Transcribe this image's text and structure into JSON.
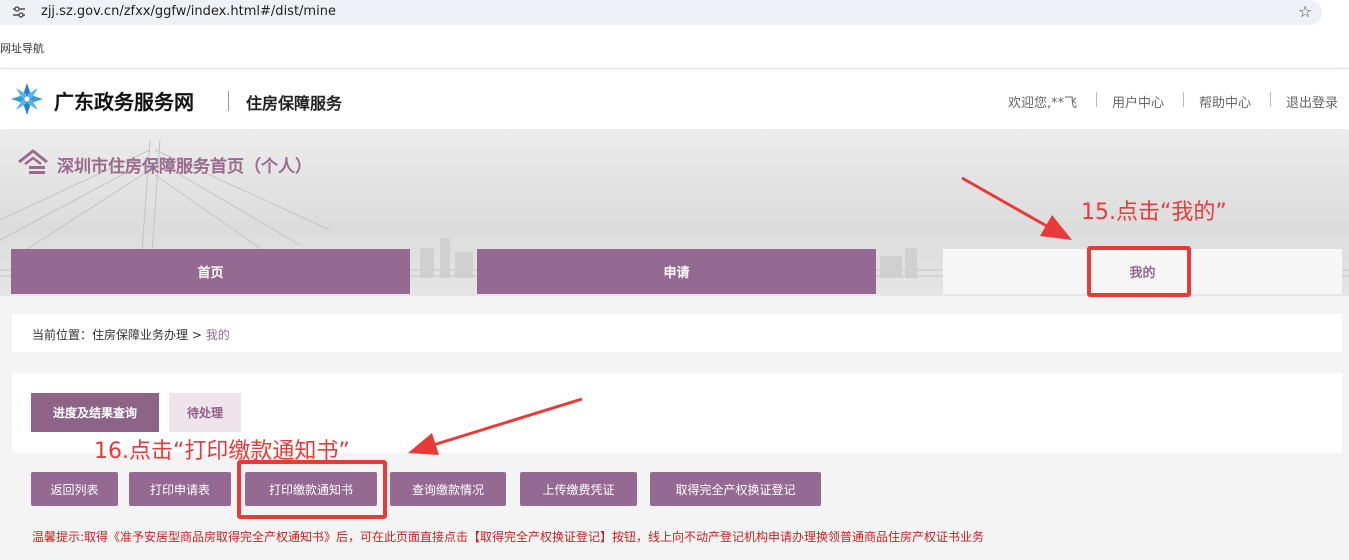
{
  "browser": {
    "url": "zjj.sz.gov.cn/zfxx/ggfw/index.html#/dist/mine",
    "bookmark": "网址导航"
  },
  "header": {
    "brand": "广东政务服务网",
    "subbrand": "住房保障服务",
    "links": [
      "欢迎您,**飞",
      "用户中心",
      "帮助中心",
      "退出登录"
    ]
  },
  "banner": {
    "title": "深圳市住房保障服务首页（个人）"
  },
  "nav": {
    "tabs": [
      "首页",
      "申请",
      "我的"
    ],
    "active": "我的"
  },
  "breadcrumb": {
    "prefix": "当前位置：住房保障业务办理 > ",
    "current": "我的"
  },
  "subtabs": [
    "进度及结果查询",
    "待处理"
  ],
  "buttons": [
    "返回列表",
    "打印申请表",
    "打印缴款通知书",
    "查询缴款情况",
    "上传缴费凭证",
    "取得完全产权换证登记"
  ],
  "tip": "温馨提示:取得《准予安居型商品房取得完全产权通知书》后，可在此页面直接点击【取得完全产权换证登记】按钮，线上向不动产登记机构申请办理换领普通商品住房产权证书业务",
  "annotations": {
    "step15": "15.点击“我的”",
    "step16": "16.点击“打印缴款通知书”"
  },
  "colors": {
    "accent": "#946a93",
    "annotation": "#e93a3a",
    "tip": "#cc1f1f"
  }
}
